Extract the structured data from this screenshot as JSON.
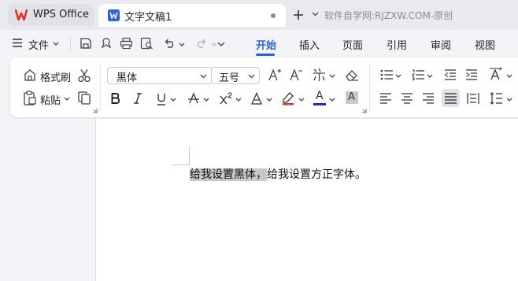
{
  "titlebar": {
    "app_tab_label": "WPS Office",
    "doc_tab_label": "文字文稿1",
    "watermark": "软件自学网:RJZXW.COM-原创"
  },
  "menu": {
    "file_label": "文件",
    "tabs": [
      "开始",
      "插入",
      "页面",
      "引用",
      "审阅",
      "视图"
    ],
    "active_tab": "开始"
  },
  "ribbon": {
    "format_painter_label": "格式刷",
    "paste_label": "粘贴",
    "font_name": "黑体",
    "font_size": "五号",
    "color_a_label": "A",
    "shade_a_label": "A"
  },
  "document": {
    "highlighted_text": "给我设置黑体，",
    "normal_text": "给我设置方正字体。"
  },
  "colors": {
    "accent": "#2e63d6",
    "wps_logo": "#e2312d",
    "font_color_bar": "#1d2bd6",
    "selection": "#c8c8c8"
  }
}
